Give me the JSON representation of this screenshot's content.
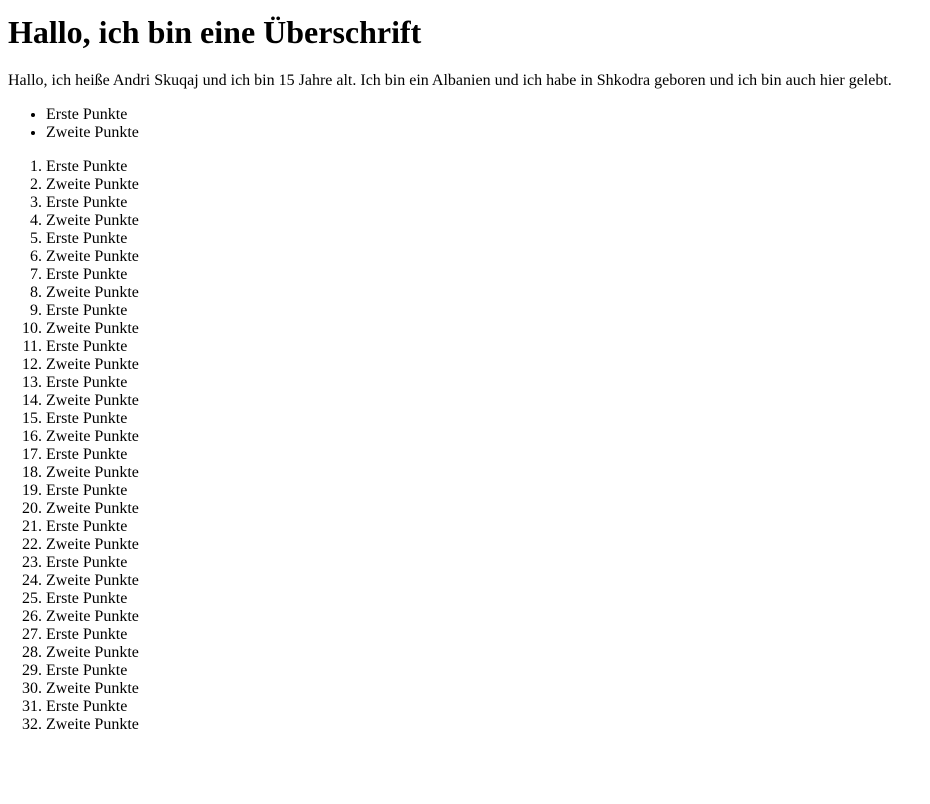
{
  "heading": "Hallo, ich bin eine Überschrift",
  "paragraph": "Hallo, ich heiße Andri Skuqaj und ich bin 15 Jahre alt. Ich bin ein Albanien und ich habe in Shkodra geboren und ich bin auch hier gelebt.",
  "unordered_list": [
    "Erste Punkte",
    "Zweite Punkte"
  ],
  "ordered_list": [
    "Erste Punkte",
    "Zweite Punkte",
    "Erste Punkte",
    "Zweite Punkte",
    "Erste Punkte",
    "Zweite Punkte",
    "Erste Punkte",
    "Zweite Punkte",
    "Erste Punkte",
    "Zweite Punkte",
    "Erste Punkte",
    "Zweite Punkte",
    "Erste Punkte",
    "Zweite Punkte",
    "Erste Punkte",
    "Zweite Punkte",
    "Erste Punkte",
    "Zweite Punkte",
    "Erste Punkte",
    "Zweite Punkte",
    "Erste Punkte",
    "Zweite Punkte",
    "Erste Punkte",
    "Zweite Punkte",
    "Erste Punkte",
    "Zweite Punkte",
    "Erste Punkte",
    "Zweite Punkte",
    "Erste Punkte",
    "Zweite Punkte",
    "Erste Punkte",
    "Zweite Punkte"
  ]
}
